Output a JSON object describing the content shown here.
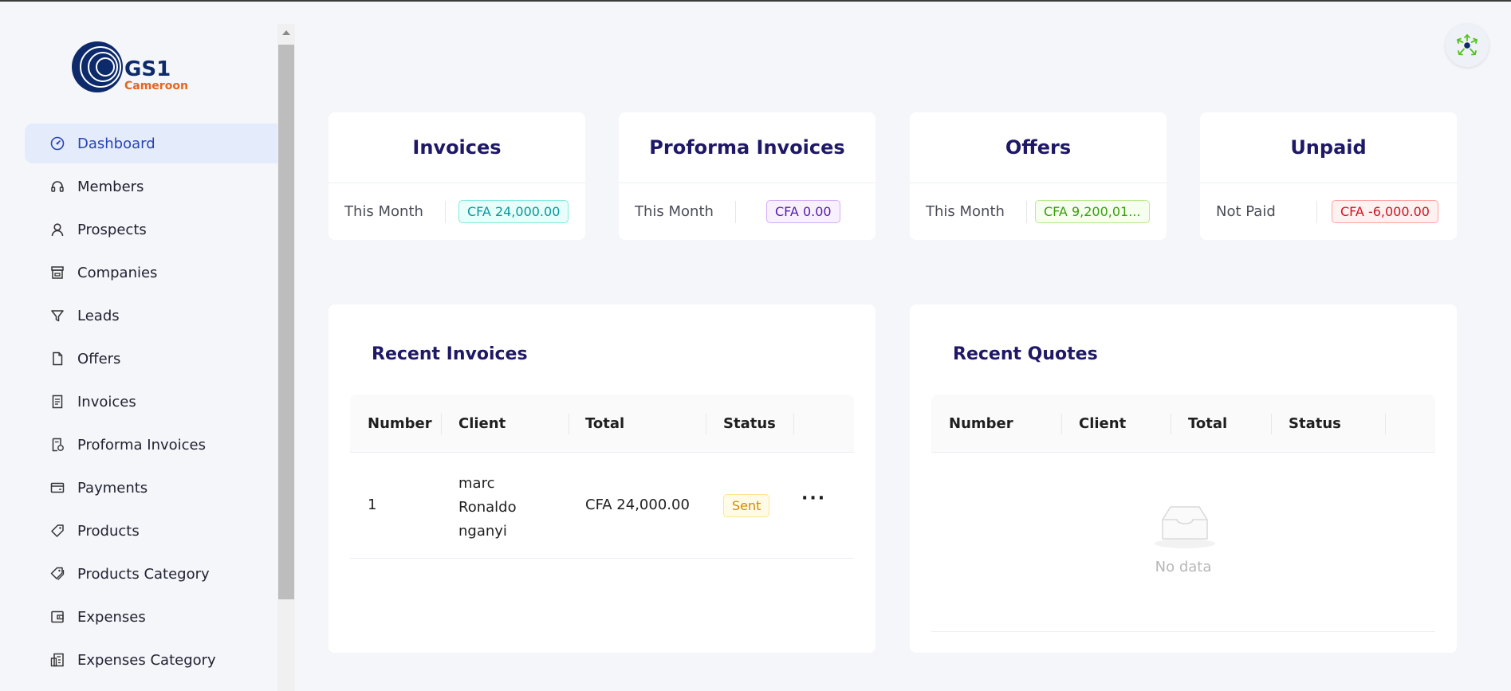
{
  "brand": {
    "logo_text": "GS1",
    "logo_sub": "Cameroon"
  },
  "sidebar": {
    "items": [
      {
        "label": "Dashboard",
        "icon": "dashboard-icon"
      },
      {
        "label": "Members",
        "icon": "headset-icon"
      },
      {
        "label": "Prospects",
        "icon": "user-icon"
      },
      {
        "label": "Companies",
        "icon": "shop-icon"
      },
      {
        "label": "Leads",
        "icon": "filter-icon"
      },
      {
        "label": "Offers",
        "icon": "file-icon"
      },
      {
        "label": "Invoices",
        "icon": "receipt-icon"
      },
      {
        "label": "Proforma Invoices",
        "icon": "file-sync-icon"
      },
      {
        "label": "Payments",
        "icon": "credit-card-icon"
      },
      {
        "label": "Products",
        "icon": "tag-icon"
      },
      {
        "label": "Products Category",
        "icon": "tags-icon"
      },
      {
        "label": "Expenses",
        "icon": "wallet-icon"
      },
      {
        "label": "Expenses Category",
        "icon": "reconciliation-icon"
      }
    ]
  },
  "stats": [
    {
      "title": "Invoices",
      "label": "This Month",
      "value": "CFA 24,000.00",
      "color": "#08979c"
    },
    {
      "title": "Proforma Invoices",
      "label": "This Month",
      "value": "CFA 0.00",
      "color": "#531dab"
    },
    {
      "title": "Offers",
      "label": "This Month",
      "value": "CFA 9,200,01...",
      "color": "#389e0d"
    },
    {
      "title": "Unpaid",
      "label": "Not Paid",
      "value": "CFA -6,000.00",
      "color": "#cf1322"
    }
  ],
  "recent_invoices": {
    "title": "Recent Invoices",
    "columns": [
      "Number",
      "Client",
      "Total",
      "Status"
    ],
    "rows": [
      {
        "number": "1",
        "client": [
          "marc",
          "Ronaldo",
          "nganyi"
        ],
        "total": "CFA 24,000.00",
        "status": "Sent"
      }
    ],
    "more": "···"
  },
  "recent_quotes": {
    "title": "Recent Quotes",
    "columns": [
      "Number",
      "Client",
      "Total",
      "Status"
    ],
    "empty_text": "No data"
  }
}
